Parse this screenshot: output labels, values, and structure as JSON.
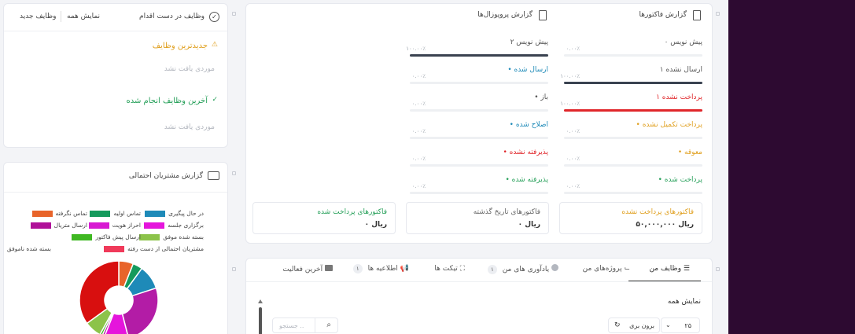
{
  "tasks": {
    "title": "وظایف در دست اقدام",
    "show_all": "نمایش همه",
    "new_task": "وظایف جدید",
    "newest_heading": "جدیدترین وظایف",
    "newest_empty": "موردی یافت نشد",
    "done_heading": "آخرین وظایف انجام شده",
    "done_empty": "موردی یافت نشد"
  },
  "leads": {
    "title": "گزارش مشتریان احتمالی",
    "legend": [
      {
        "label": "در حال پیگیری",
        "color": "#1e8ab8"
      },
      {
        "label": "تماس اولیه",
        "color": "#159a5c"
      },
      {
        "label": "تماس نگرفته",
        "color": "#e8642a"
      },
      {
        "label": "برگزاری جلسه",
        "color": "#e515dc"
      },
      {
        "label": "احراز هویت",
        "color": "#d81ad2"
      },
      {
        "label": "ارسال متریال",
        "color": "#b01199"
      },
      {
        "label": "بسته شده موفق",
        "color": "#8cc34a"
      },
      {
        "label": "ارسال پیش فاکتور",
        "color": "#3fb822"
      },
      {
        "label": "مشتریان احتمالی از دست رفته",
        "color": "#f03a5a"
      },
      {
        "label": "بسته شده ناموفق",
        "color": "#d80f0f"
      }
    ],
    "chart_data": {
      "type": "pie",
      "labels": [
        "تماس نگرفته",
        "تماس اولیه",
        "در حال پیگیری",
        "برگزاری جلسه",
        "احراز هویت",
        "ارسال متریال",
        "ارسال پیش فاکتور",
        "بسته شده موفق",
        "بسته شده ناموفق"
      ],
      "values": [
        6,
        4,
        10,
        26,
        10,
        1,
        1,
        7,
        35
      ],
      "colors": [
        "#e8642a",
        "#159a5c",
        "#1e8ab8",
        "#b31ca6",
        "#e515dc",
        "#b01199",
        "#3fb822",
        "#8cc34a",
        "#d80f0f"
      ]
    }
  },
  "invoices": {
    "title": "گزارش فاکتورها",
    "items": [
      {
        "label": "۰ پیش نویس",
        "pct": "۰.۰۰٪",
        "fill": 0,
        "color": "#3a4250",
        "label_color": "#555"
      },
      {
        "label": "۱ ارسال نشده",
        "pct": "۱۰۰.۰۰٪",
        "fill": 100,
        "color": "#3a4250",
        "label_color": "#555"
      },
      {
        "label": "۱ پرداخت نشده",
        "pct": "۱۰۰.۰۰٪",
        "fill": 100,
        "color": "#e0262a",
        "label_color": "#e0262a"
      },
      {
        "label": "• پرداخت تکمیل نشده",
        "pct": "۰.۰۰٪",
        "fill": 0,
        "color": "#e0a020",
        "label_color": "#e0a020"
      },
      {
        "label": "• معوقه",
        "pct": "۰.۰۰٪",
        "fill": 0,
        "color": "#e0a020",
        "label_color": "#e0a020"
      },
      {
        "label": "• پرداخت شده",
        "pct": "۰.۰۰٪",
        "fill": 0,
        "color": "#27a05a",
        "label_color": "#27a05a"
      }
    ]
  },
  "proposals": {
    "title": "گزارش پروپوزال‌ها",
    "items": [
      {
        "label": "۲ پیش نویس",
        "pct": "۱۰۰.۰۰٪",
        "fill": 100,
        "color": "#3a4250",
        "label_color": "#555"
      },
      {
        "label": "• ارسال شده",
        "pct": "۰.۰۰٪",
        "fill": 0,
        "color": "#1e8ab8",
        "label_color": "#1e8ab8"
      },
      {
        "label": "• باز",
        "pct": "۰.۰۰٪",
        "fill": 0,
        "color": "#3a4250",
        "label_color": "#555"
      },
      {
        "label": "• اصلاح شده",
        "pct": "۰.۰۰٪",
        "fill": 0,
        "color": "#1e8ab8",
        "label_color": "#1e8ab8"
      },
      {
        "label": "• پذیرفته نشده",
        "pct": "۰.۰۰٪",
        "fill": 0,
        "color": "#e0262a",
        "label_color": "#e0262a"
      },
      {
        "label": "• پذیرفته شده",
        "pct": "۰.۰۰٪",
        "fill": 0,
        "color": "#27a05a",
        "label_color": "#27a05a"
      }
    ]
  },
  "summary": [
    {
      "label": "فاکتورهای پرداخت نشده",
      "value": "۵۰,۰۰۰,۰۰۰ ریال",
      "label_color": "#e0a020"
    },
    {
      "label": "فاکتورهای تاریخ گذشته",
      "value": "۰ ریال",
      "label_color": "#666"
    },
    {
      "label": "فاکتورهای پرداخت شده",
      "value": "۰ ریال",
      "label_color": "#27a05a"
    }
  ],
  "tabs": {
    "my_tasks": "وظایف من",
    "my_projects": "پروژه‌های من",
    "my_reminders": "یادآوری های من",
    "reminders_count": "۱",
    "tickets": "تیکت ها",
    "announcements": "اطلاعیه ها",
    "announcements_count": "۱",
    "last_activity": "آخرین فعالیت"
  },
  "table": {
    "show_all": "نمایش همه",
    "page_size": "۲۵",
    "export": "برون بری",
    "search_placeholder": "جستجو .."
  }
}
